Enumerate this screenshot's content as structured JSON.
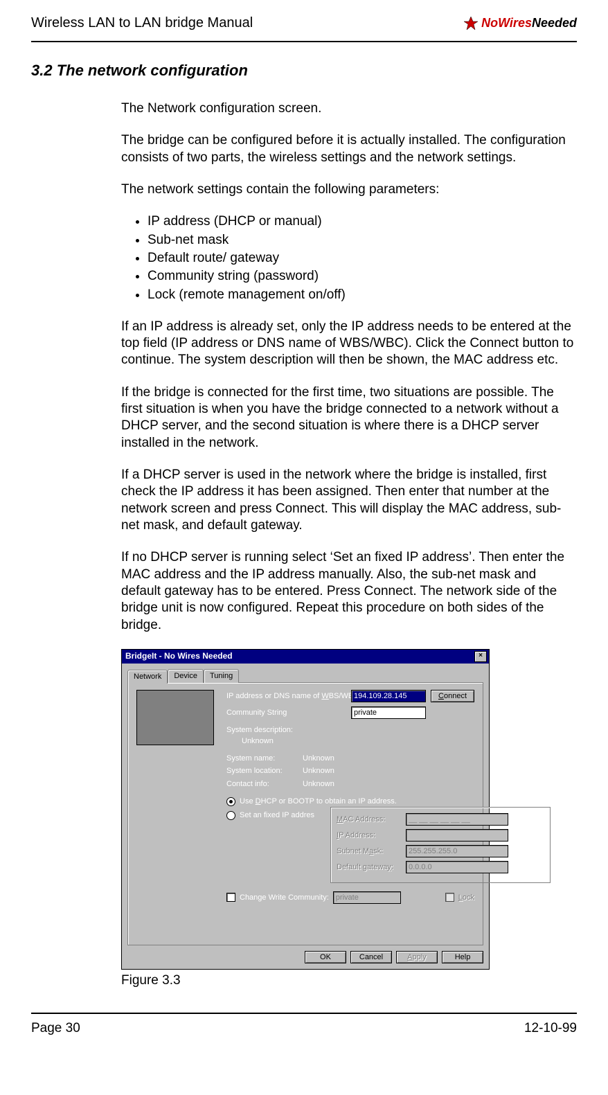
{
  "header": {
    "doc_title": "Wireless LAN to LAN bridge Manual",
    "logo_red": "NoWires",
    "logo_black": "Needed"
  },
  "section_title": "3.2 The network configuration",
  "paragraphs": {
    "p1": "The Network configuration screen.",
    "p2": "The bridge can be configured before it is actually installed. The configuration consists of two parts, the wireless settings and the network settings.",
    "p3": "The network settings contain the following parameters:",
    "p4": "If an IP address is already set, only the IP address needs to be entered at the top field (IP address or DNS name of WBS/WBC). Click the Connect button to continue. The system description will then be shown, the MAC address etc.",
    "p5": "If the bridge is connected for the first time, two situations are possible. The first situation is when you have the bridge connected to a network without a DHCP server, and the second situation is where there is a DHCP server installed in the network.",
    "p6": "If a DHCP server is used in the network where the bridge is installed, first check the IP address it has been assigned. Then enter that number at the network screen and press Connect. This will display the MAC address, sub-net mask, and default gateway.",
    "p7": "If no DHCP server is running select ‘Set an fixed IP address’. Then enter the MAC address and the IP address manually. Also, the sub-net mask and default gateway has to be entered. Press Connect. The network side of the bridge unit is now configured. Repeat this procedure on both sides of the bridge."
  },
  "bullets": [
    "IP address (DHCP or manual)",
    "Sub-net mask",
    "Default route/ gateway",
    "Community string (password)",
    "Lock (remote management on/off)"
  ],
  "figure_caption": "Figure 3.3",
  "dialog": {
    "title": "BridgeIt - No Wires Needed",
    "tabs": [
      "Network",
      "Device",
      "Tuning"
    ],
    "ip_dns_label_pre": "IP address or DNS name of ",
    "ip_dns_label_ul": "W",
    "ip_dns_label_post": "BS/WBC:",
    "ip_dns_value": "194.109.28.145",
    "connect_pre": "",
    "connect_ul": "C",
    "connect_post": "onnect",
    "comm_label": "Community String",
    "comm_value": "private",
    "sys_desc_label": "System description:",
    "sys_desc_value": "Unknown",
    "sys_name_label": "System name:",
    "sys_name_value": "Unknown",
    "sys_loc_label": "System location:",
    "sys_loc_value": "Unknown",
    "contact_label": "Contact info:",
    "contact_value": "Unknown",
    "radio_dhcp_pre": "Use ",
    "radio_dhcp_ul": "D",
    "radio_dhcp_post": "HCP or BOOTP to obtain an IP address.",
    "radio_fixed": "Set an fixed IP addres",
    "mac_label_ul": "M",
    "mac_label_post": "AC Address:",
    "mac_value": "__ __ __ __ __ __",
    "ipaddr_label_ul": "I",
    "ipaddr_label_post": "P Address:",
    "ipaddr_value": "",
    "subnet_label_pre": "Subnet M",
    "subnet_label_ul": "a",
    "subnet_label_post": "sk:",
    "subnet_value": "255.255.255.0",
    "gateway_label_pre": "Default gatewa",
    "gateway_label_ul": "y",
    "gateway_label_post": ":",
    "gateway_value": "0.0.0.0",
    "cwc_label": "Change Write Community:",
    "cwc_value": "private",
    "lock_label_ul": "L",
    "lock_label_post": "ock",
    "ok": "OK",
    "cancel": "Cancel",
    "apply_ul": "A",
    "apply_post": "pply",
    "help": "Help"
  },
  "footer": {
    "page": "Page 30",
    "date": "12-10-99"
  }
}
